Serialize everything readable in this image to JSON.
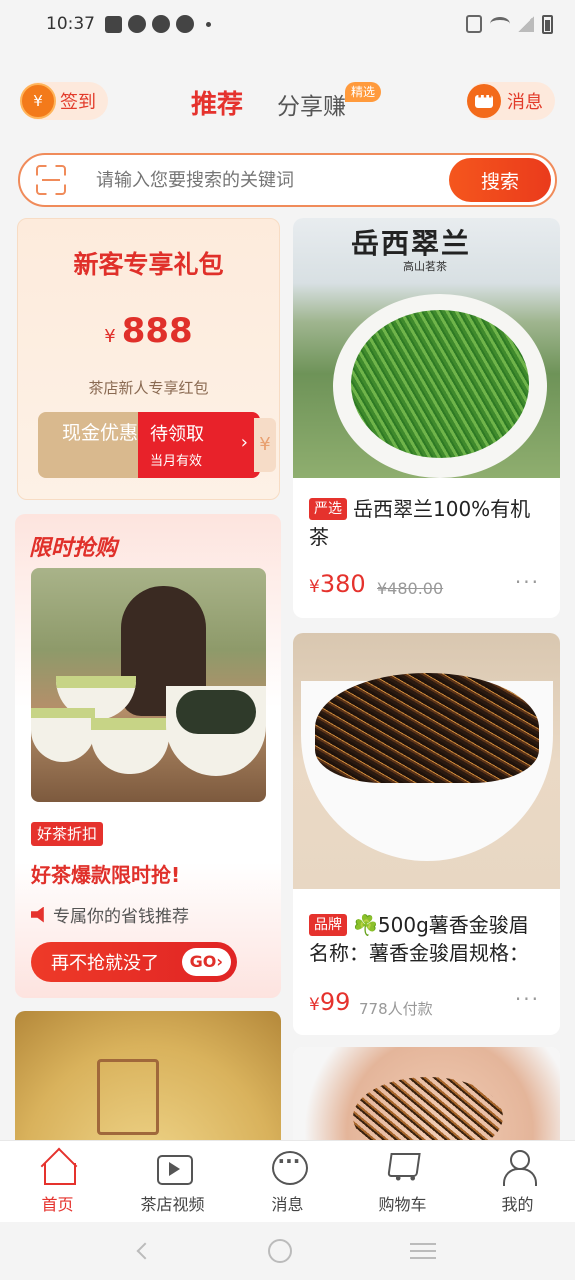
{
  "status_bar": {
    "time": "10:37"
  },
  "header": {
    "checkin_label": "签到",
    "checkin_coin": "¥",
    "tabs": [
      {
        "label": "推荐",
        "active": true
      },
      {
        "label": "分享赚",
        "badge": "精选",
        "active": false
      }
    ],
    "messages_label": "消息"
  },
  "search": {
    "placeholder": "请输入您要搜索的关键词",
    "button_label": "搜索"
  },
  "gift_card": {
    "title": "新客专享礼包",
    "currency": "¥",
    "amount": "888",
    "subtitle": "茶店新人专享红包",
    "coupon_left": "现金优惠",
    "coupon_action": "待领取",
    "coupon_validity": "当月有效",
    "coupon_tail": "¥"
  },
  "flash_sale": {
    "title": "限时抢购",
    "tag": "好茶折扣",
    "headline": "好茶爆款限时抢!",
    "description": "专属你的省钱推荐",
    "button_label": "再不抢就没了",
    "go_label": "GO"
  },
  "products": [
    {
      "image_text": "岳西翠兰",
      "image_subtext": "高山茗茶",
      "tag": "严选",
      "title": "岳西翠兰100%有机茶",
      "currency": "¥",
      "price": "380",
      "old_price": "¥480.00",
      "more": "···"
    },
    {
      "tag": "品牌",
      "title": "☘️500g薯香金骏眉名称：薯香金骏眉规格：",
      "currency": "¥",
      "price": "99",
      "buyers": "778人付款",
      "more": "···"
    }
  ],
  "bottom_nav": [
    {
      "label": "首页",
      "icon": "home-icon",
      "active": true
    },
    {
      "label": "茶店视频",
      "icon": "video-icon",
      "active": false
    },
    {
      "label": "消息",
      "icon": "message-icon",
      "active": false
    },
    {
      "label": "购物车",
      "icon": "cart-icon",
      "active": false
    },
    {
      "label": "我的",
      "icon": "profile-icon",
      "active": false
    }
  ],
  "colors": {
    "accent": "#e5322d",
    "orange": "#f5561d",
    "bg": "#f4f4f4"
  }
}
